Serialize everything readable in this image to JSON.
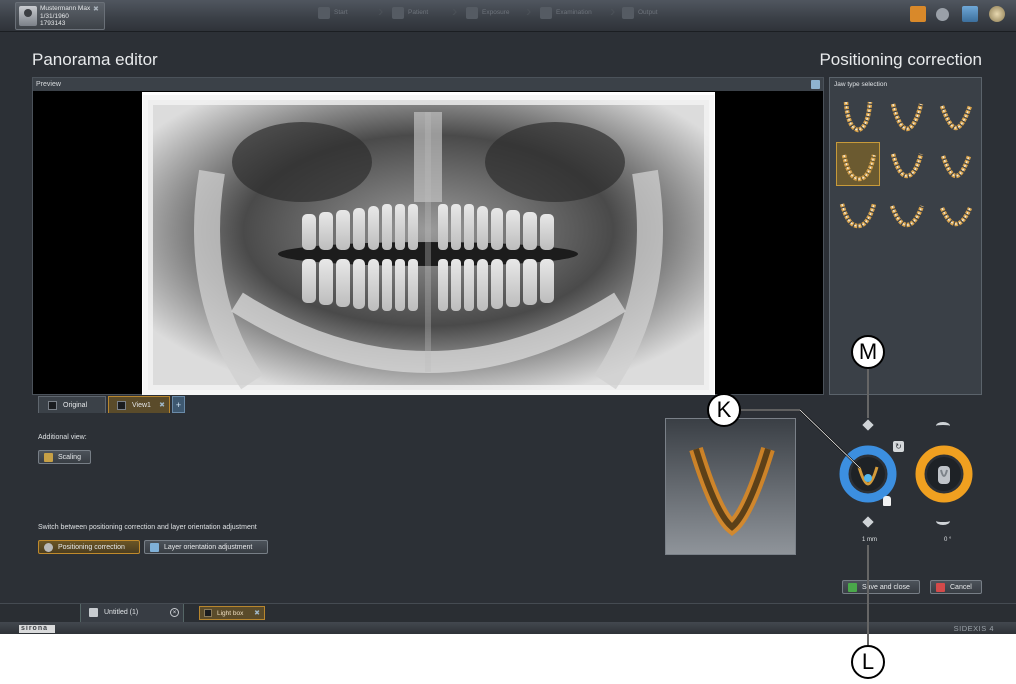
{
  "patient": {
    "name": "Mustermann Max",
    "dob": "1/31/1960",
    "id": "1793143"
  },
  "wizard": [
    "Start",
    "Patient",
    "Exposure",
    "Examination",
    "Output"
  ],
  "editor_title": "Panorama editor",
  "panel_title": "Positioning correction",
  "preview_label": "Preview",
  "view_tabs": {
    "original": "Original",
    "view1": "View1"
  },
  "additional_view": "Additional view:",
  "scaling": "Scaling",
  "switch_label": "Switch between positioning correction and layer orientation adjustment",
  "mode_buttons": {
    "positioning": "Positioning correction",
    "layer": "Layer orientation adjustment"
  },
  "jaw_panel_title": "Jaw type selection",
  "jaw_selected_index": 3,
  "controls": {
    "position_value": "1",
    "position_unit": "mm",
    "rotation_value": "0",
    "rotation_unit": "°"
  },
  "actions": {
    "save": "Save and close",
    "cancel": "Cancel"
  },
  "tabs": {
    "untitled": "Untitled (1)",
    "lightbox": "Light box"
  },
  "brand": "sirona",
  "product": "SIDEXIS 4",
  "callouts": {
    "k": "K",
    "l": "L",
    "m": "M"
  },
  "colors": {
    "accent_orange": "#c9902f",
    "blue_ring": "#3c8fe0",
    "orange_ring": "#f0a020",
    "background": "#2c3036"
  }
}
